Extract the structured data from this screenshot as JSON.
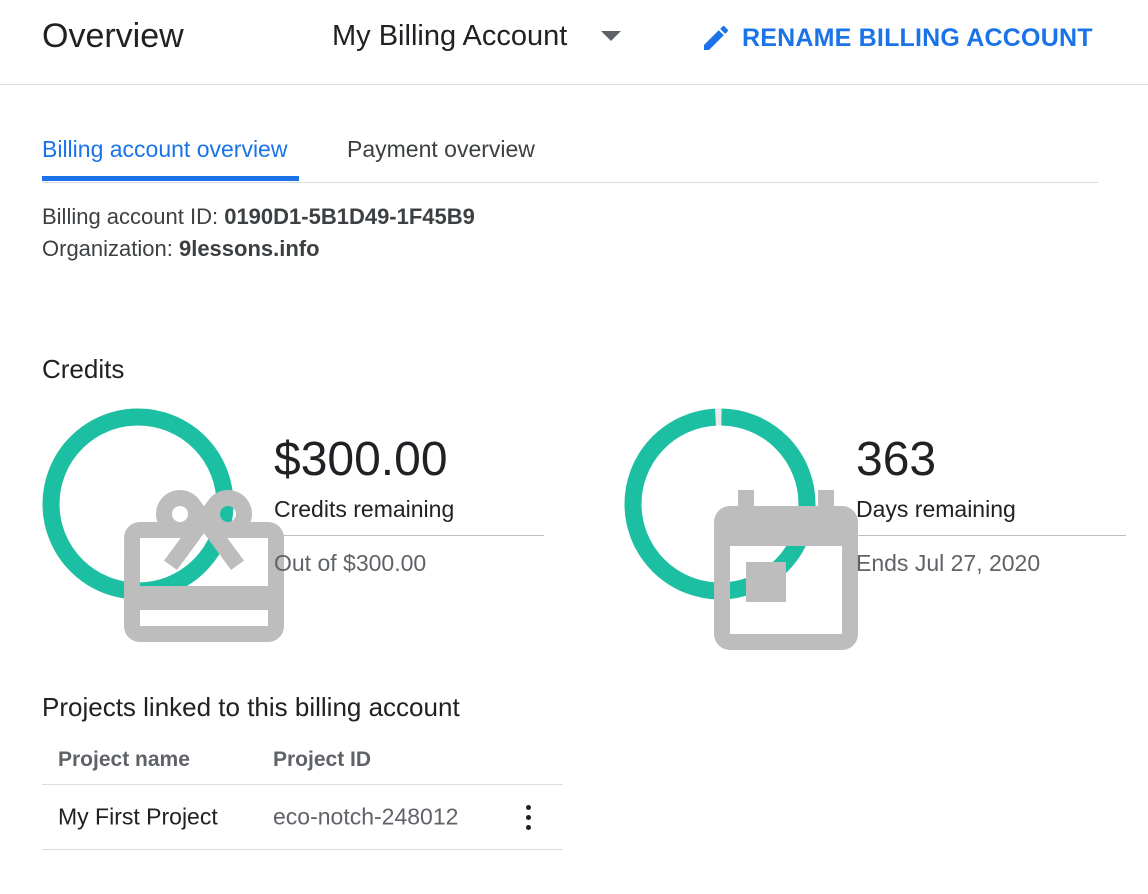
{
  "header": {
    "title": "Overview",
    "account_name": "My Billing Account",
    "rename_label": "RENAME BILLING ACCOUNT"
  },
  "tabs": [
    {
      "label": "Billing account overview",
      "active": true
    },
    {
      "label": "Payment overview",
      "active": false
    }
  ],
  "account": {
    "id_label": "Billing account ID: ",
    "id_value": "0190D1-5B1D49-1F45B9",
    "org_label": "Organization: ",
    "org_value": "9lessons.info"
  },
  "credits": {
    "section_title": "Credits",
    "amount": "$300.00",
    "amount_label": "Credits remaining",
    "amount_total": "Out of $300.00",
    "amount_fraction": 1.0,
    "days": "363",
    "days_label": "Days remaining",
    "days_end": "Ends Jul 27, 2020",
    "days_fraction": 0.994,
    "ring_color": "#1dbfa2",
    "icon_credits": "gift-card-icon",
    "icon_days": "calendar-icon"
  },
  "projects": {
    "section_title": "Projects linked to this billing account",
    "columns": [
      "Project name",
      "Project ID"
    ],
    "rows": [
      {
        "name": "My First Project",
        "id": "eco-notch-248012"
      }
    ]
  },
  "colors": {
    "accent": "#1a73e8",
    "ring": "#1dbfa2",
    "icon_gray": "#bdbdbd"
  }
}
